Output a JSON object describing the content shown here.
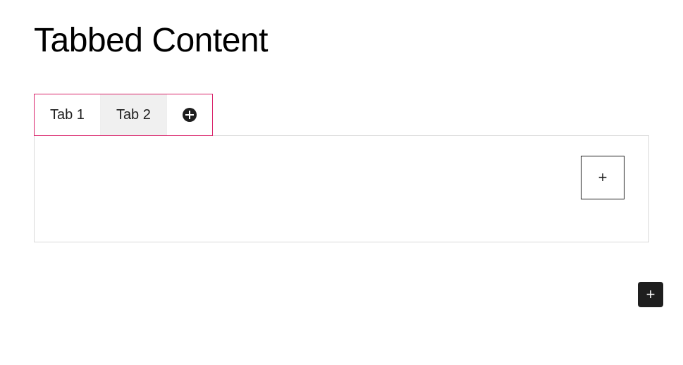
{
  "title": "Tabbed Content",
  "tabs": {
    "items": [
      {
        "label": "Tab 1",
        "active": false
      },
      {
        "label": "Tab 2",
        "active": true
      }
    ],
    "addIcon": "plus-circle"
  },
  "panel": {
    "addBlockIcon": "+"
  },
  "floatingAdd": {
    "icon": "+"
  },
  "colors": {
    "selection": "#d9236a",
    "panelBorder": "#d9d9d9",
    "activeTabBg": "#f0f0f0",
    "floatingBg": "#1e1e1e"
  }
}
